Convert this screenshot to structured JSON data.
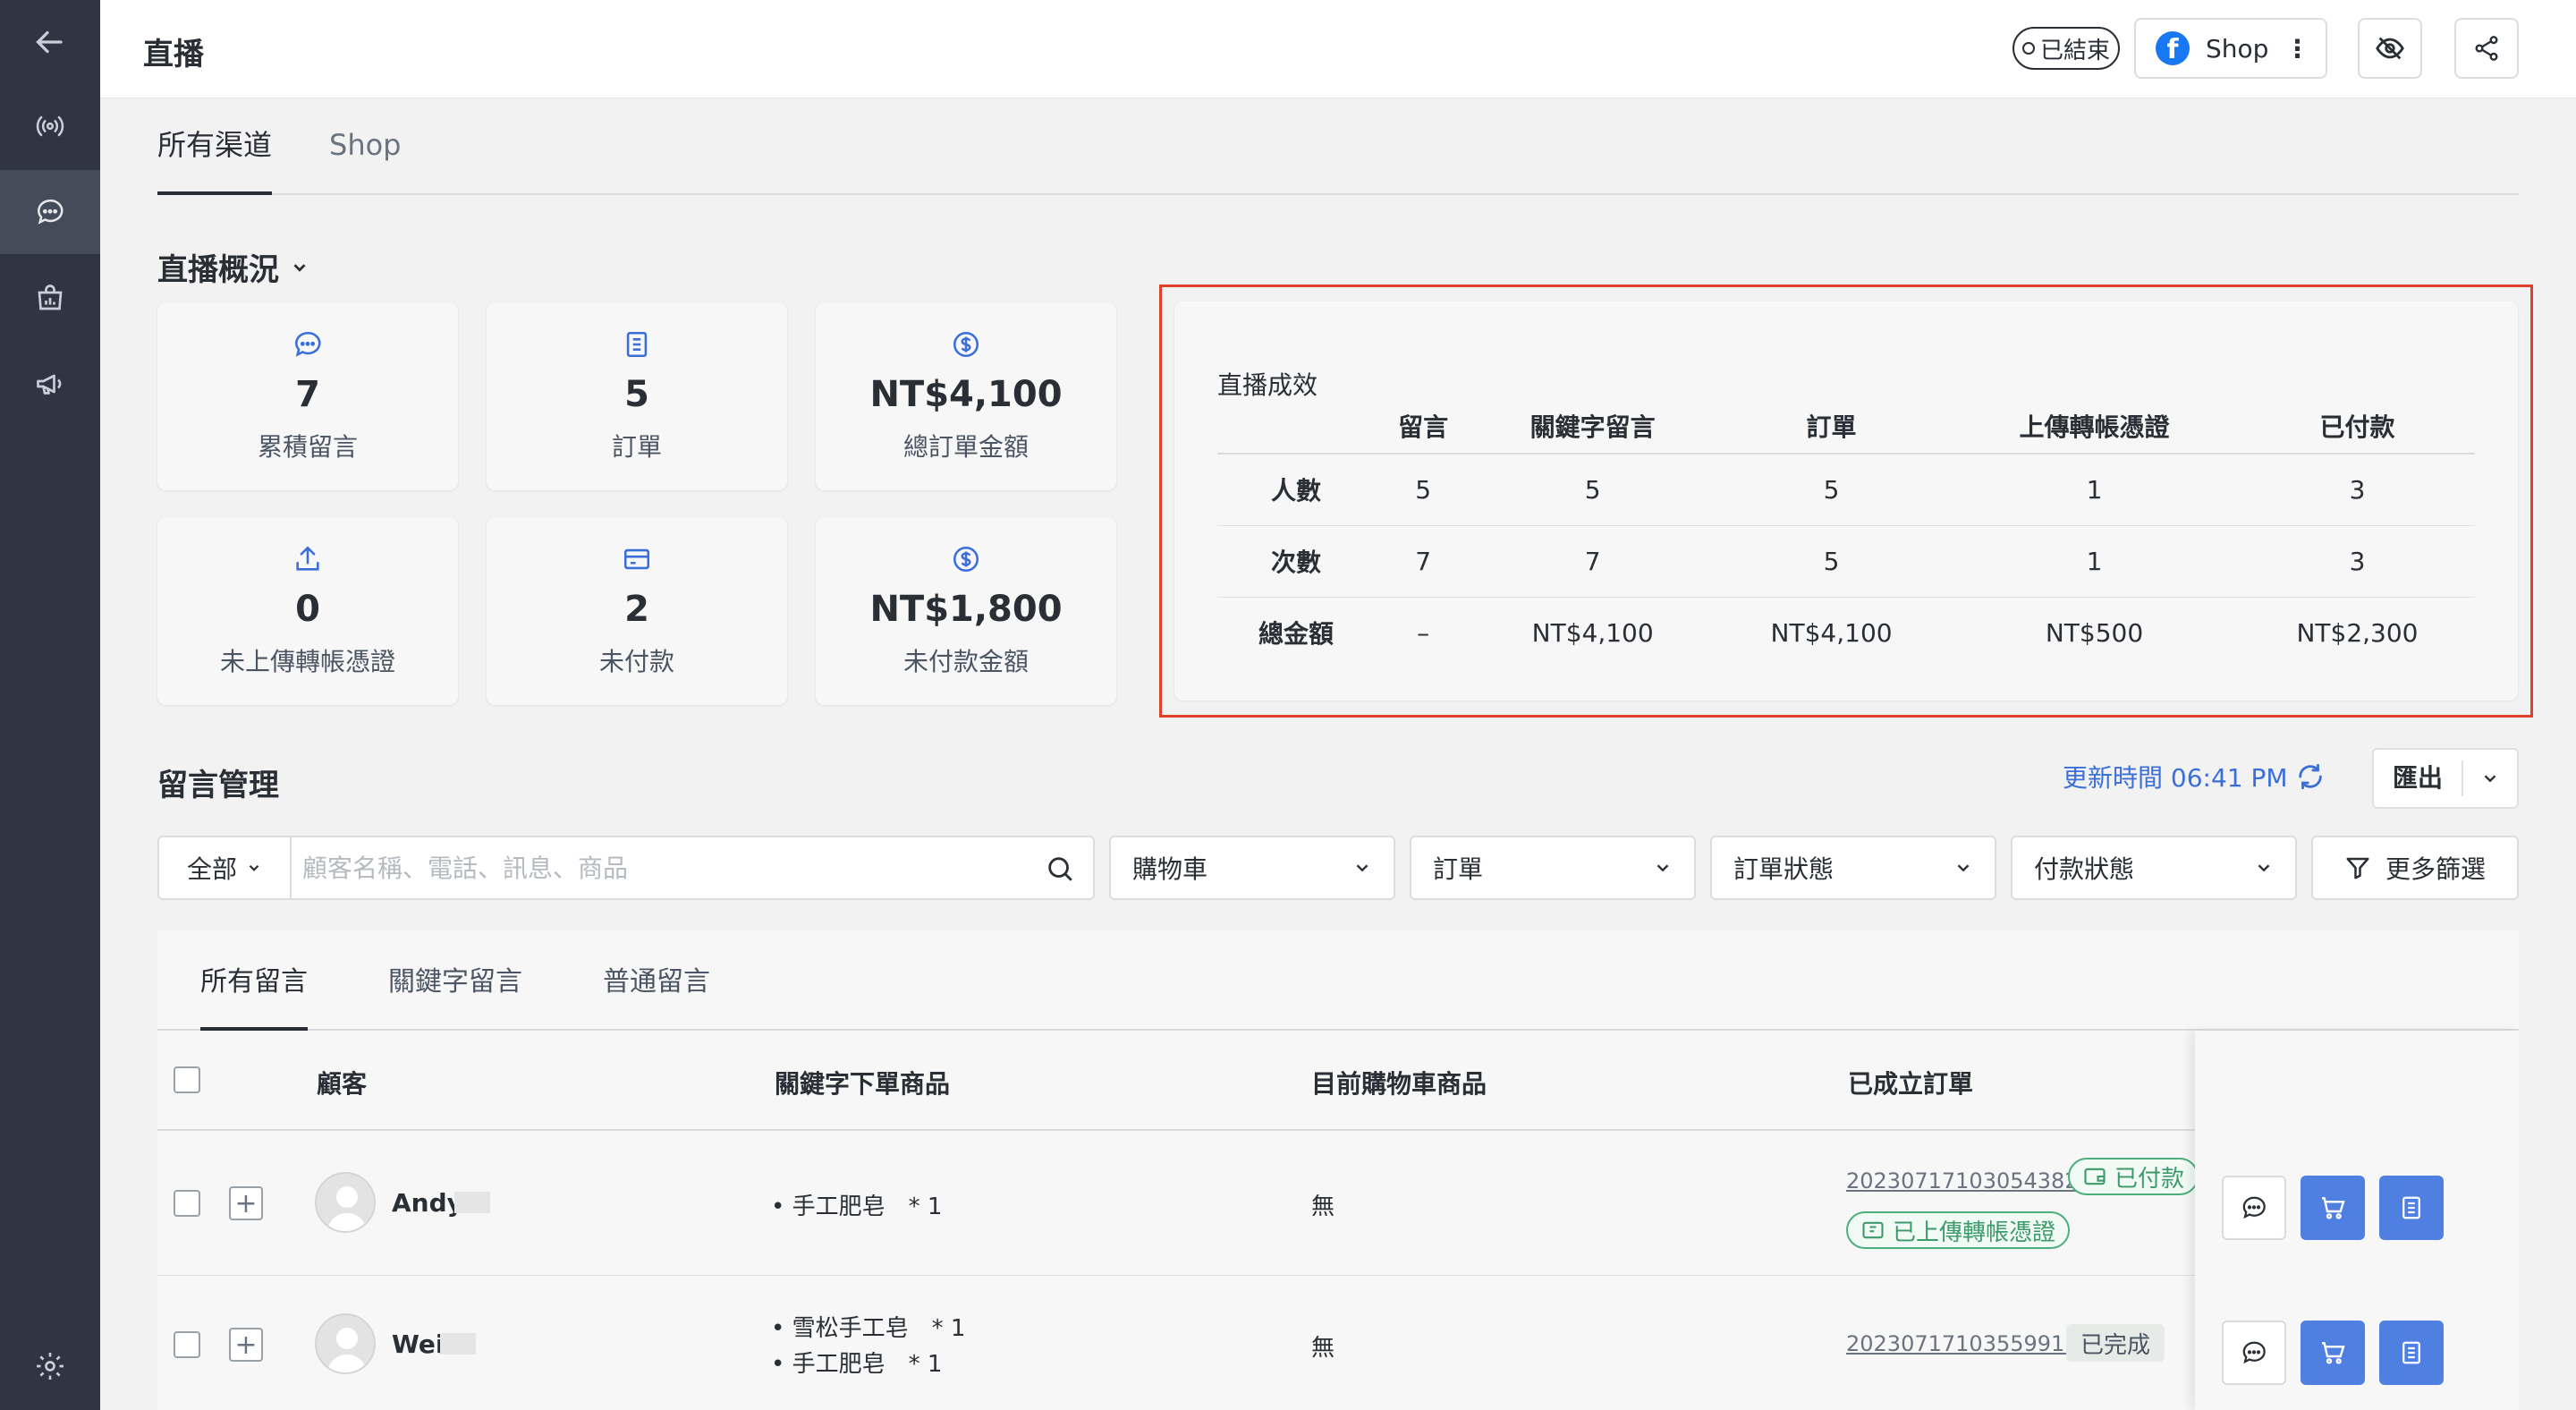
{
  "sidebar": {
    "items": [
      "back-arrow-icon",
      "broadcast-icon",
      "chat-icon",
      "store-analytics-icon",
      "megaphone-icon",
      "settings-icon"
    ]
  },
  "header": {
    "title": "直播",
    "status_label": "已結束",
    "channel_label": "Shop"
  },
  "channel_tabs": [
    "所有渠道",
    "Shop"
  ],
  "overview": {
    "title": "直播概況",
    "cards": [
      {
        "value": "7",
        "label": "累積留言",
        "icon": "comment-icon"
      },
      {
        "value": "5",
        "label": "訂單",
        "icon": "order-icon"
      },
      {
        "value": "NT$4,100",
        "label": "總訂單金額",
        "icon": "dollar-icon"
      },
      {
        "value": "0",
        "label": "未上傳轉帳憑證",
        "icon": "upload-icon"
      },
      {
        "value": "2",
        "label": "未付款",
        "icon": "card-icon"
      },
      {
        "value": "NT$1,800",
        "label": "未付款金額",
        "icon": "dollar-icon"
      }
    ]
  },
  "performance": {
    "title": "直播成效",
    "columns": [
      "留言",
      "關鍵字留言",
      "訂單",
      "上傳轉帳憑證",
      "已付款"
    ],
    "rows": [
      {
        "label": "人數",
        "values": [
          "5",
          "5",
          "5",
          "1",
          "3"
        ]
      },
      {
        "label": "次數",
        "values": [
          "7",
          "7",
          "5",
          "1",
          "3"
        ]
      },
      {
        "label": "總金額",
        "values": [
          "–",
          "NT$4,100",
          "NT$4,100",
          "NT$500",
          "NT$2,300"
        ]
      }
    ]
  },
  "comments": {
    "title": "留言管理",
    "updated": "更新時間 06:41 PM",
    "export_label": "匯出",
    "scope": "全部",
    "search_placeholder": "顧客名稱、電話、訊息、商品",
    "filters": [
      "購物車",
      "訂單",
      "訂單狀態",
      "付款狀態"
    ],
    "more_filters": "更多篩選",
    "tabs": [
      "所有留言",
      "關鍵字留言",
      "普通留言"
    ],
    "columns": [
      "顧客",
      "關鍵字下單商品",
      "目前購物車商品",
      "已成立訂單"
    ],
    "rows": [
      {
        "name": "Andy",
        "keyword_items": [
          "手工肥皂　* 1"
        ],
        "cart": "無",
        "order_no": "20230717103054382",
        "badges": [
          "已付款",
          "已上傳轉帳憑證"
        ]
      },
      {
        "name": "Wei",
        "keyword_items": [
          "雪松手工皂　* 1",
          "手工肥皂　* 1"
        ],
        "cart": "無",
        "order_no": "20230717103559915",
        "badges": [
          "已完成"
        ]
      }
    ]
  },
  "colors": {
    "sidebar": "#2f3542",
    "accent": "#4f7fe0",
    "highlight_border": "#e0412f",
    "paid_green": "#4caf7d",
    "link_blue": "#3b6fd8"
  }
}
